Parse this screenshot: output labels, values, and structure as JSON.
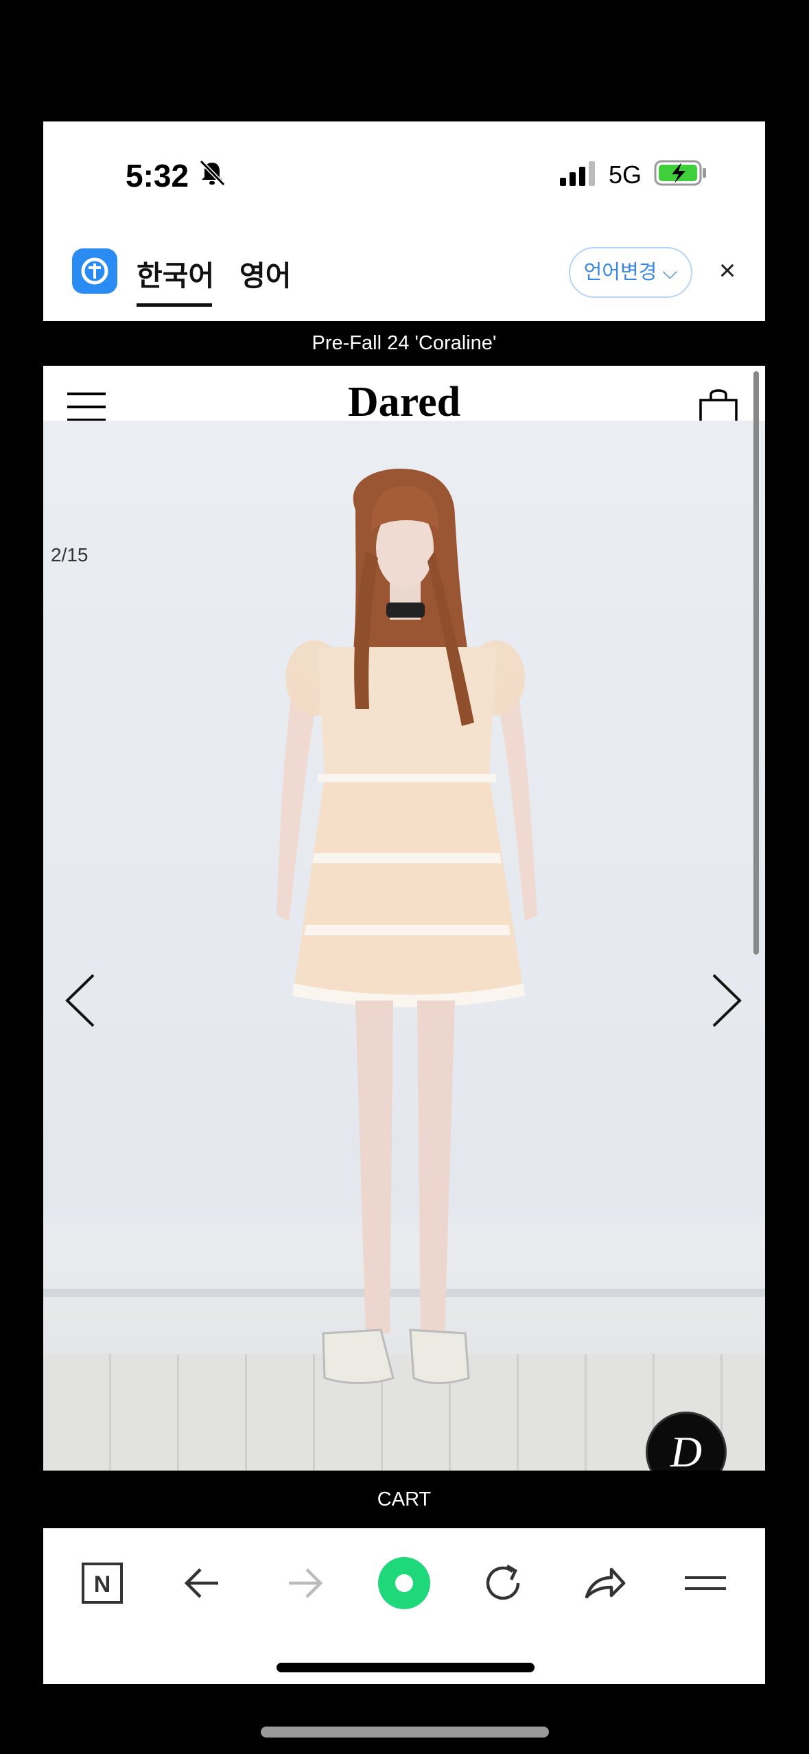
{
  "status_bar": {
    "time": "5:32",
    "network": "5G",
    "icons": [
      "bell-off-icon",
      "signal-icon",
      "battery-charging-icon"
    ]
  },
  "translate_bar": {
    "tabs": [
      {
        "label": "한국어",
        "active": true
      },
      {
        "label": "영어",
        "active": false
      }
    ],
    "change_button": "언어변경 ⌵",
    "close_label": "×",
    "accent_color": "#2a8bf2"
  },
  "store": {
    "promo_text": "Pre-Fall 24 'Coraline'",
    "brand": "Dared",
    "slide_counter": "2/15",
    "badge_letter": "D",
    "cart_label": "CART"
  },
  "browser_toolbar": {
    "buttons": [
      "naver-home-icon",
      "back-arrow-icon",
      "forward-arrow-icon",
      "green-circle-icon",
      "reload-icon",
      "share-icon",
      "menu-lines-icon"
    ],
    "naver_letter": "N"
  }
}
